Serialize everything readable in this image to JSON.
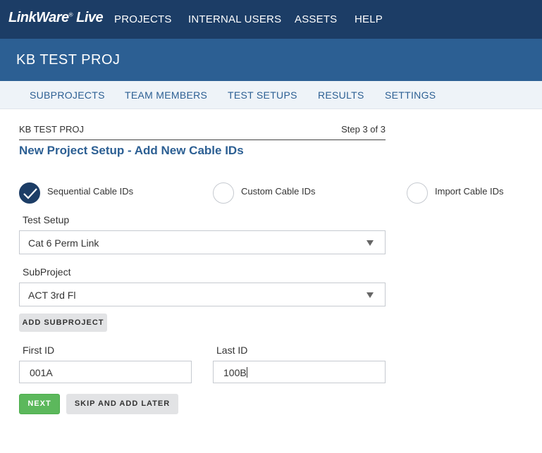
{
  "brand": {
    "logo": "LinkWare",
    "logo_suffix": "Live",
    "reg_mark": "®"
  },
  "top_nav": [
    "PROJECTS",
    "INTERNAL USERS",
    "ASSETS",
    "HELP"
  ],
  "project": {
    "title": "KB TEST PROJ"
  },
  "sub_nav": [
    "SUBPROJECTS",
    "TEAM MEMBERS",
    "TEST SETUPS",
    "RESULTS",
    "SETTINGS"
  ],
  "wizard": {
    "breadcrumb": "KB TEST PROJ",
    "step": "Step 3 of 3",
    "heading": "New Project Setup - Add New Cable IDs",
    "options": [
      {
        "label": "Sequential Cable IDs",
        "checked": true
      },
      {
        "label": "Custom Cable IDs",
        "checked": false
      },
      {
        "label": "Import Cable IDs",
        "checked": false
      }
    ],
    "test_setup": {
      "label": "Test Setup",
      "value": "Cat 6 Perm Link"
    },
    "subproject": {
      "label": "SubProject",
      "value": "ACT 3rd Fl"
    },
    "add_subproject": "ADD SUBPROJECT",
    "first_id": {
      "label": "First ID",
      "value": "001A"
    },
    "last_id": {
      "label": "Last ID",
      "value": "100B"
    },
    "next": "NEXT",
    "skip": "SKIP AND ADD LATER"
  },
  "colors": {
    "topbar": "#1c3d66",
    "projbar": "#2c5f93",
    "subnav": "#eef3f8",
    "accent": "#2c5f93",
    "next_button": "#5cb85c"
  }
}
